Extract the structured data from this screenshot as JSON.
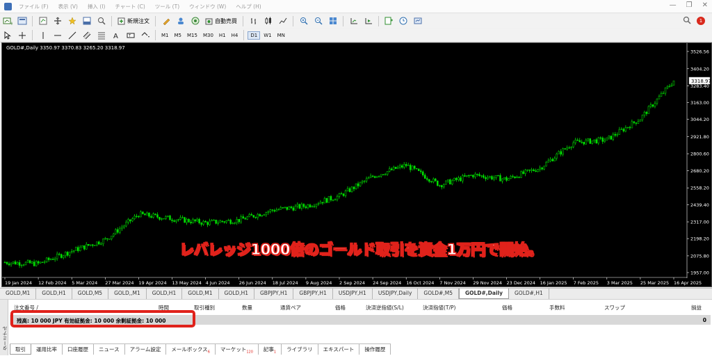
{
  "menu": {
    "items": [
      "ファイル (F)",
      "表示 (V)",
      "挿入 (I)",
      "チャート (C)",
      "ツール (T)",
      "ウィンドウ (W)",
      "ヘルプ (H)"
    ],
    "window_controls": [
      "—",
      "❐",
      "✕"
    ]
  },
  "toolbar": {
    "new_order": "新規注文",
    "auto_trade": "自動売買",
    "timeframes": [
      "M1",
      "M5",
      "M15",
      "M30",
      "H1",
      "H4",
      "D1",
      "W1",
      "MN"
    ],
    "active_timeframe": "D1",
    "notification_count": "1"
  },
  "chart": {
    "header": "GOLD#,Daily  3350.97 3370.83 3265.20 3318.97",
    "price_label": "3318.97",
    "caption": "レバレッジ1000倍のゴールド取引を資金1万円で開始。",
    "colors": {
      "background": "#000000",
      "candles": "#00e000",
      "axis_text": "#ffffff"
    }
  },
  "chart_data": {
    "type": "line",
    "title": "GOLD#,Daily",
    "ohlc_last": {
      "open": 3350.97,
      "high": 3370.83,
      "low": 3265.2,
      "close": 3318.97
    },
    "y_ticks": [
      "3526.56",
      "3404.20",
      "3283.40",
      "3163.00",
      "3044.20",
      "2921.80",
      "2800.60",
      "2680.20",
      "2558.20",
      "2439.40",
      "2317.00",
      "2198.20",
      "2075.80",
      "1957.00"
    ],
    "ylim": [
      1957.0,
      3526.56
    ],
    "x_ticks": [
      "19 Jan 2024",
      "12 Feb 2024",
      "5 Mar 2024",
      "27 Mar 2024",
      "19 Apr 2024",
      "13 May 2024",
      "4 Jun 2024",
      "26 Jun 2024",
      "18 Jul 2024",
      "9 Aug 2024",
      "2 Sep 2024",
      "24 Sep 2024",
      "16 Oct 2024",
      "7 Nov 2024",
      "29 Nov 2024",
      "23 Dec 2024",
      "16 Jan 2025",
      "7 Feb 2025",
      "3 Mar 2025",
      "25 Mar 2025",
      "16 Apr 2025"
    ],
    "x": [
      "19 Jan 2024",
      "12 Feb 2024",
      "5 Mar 2024",
      "27 Mar 2024",
      "19 Apr 2024",
      "13 May 2024",
      "4 Jun 2024",
      "26 Jun 2024",
      "18 Jul 2024",
      "9 Aug 2024",
      "2 Sep 2024",
      "24 Sep 2024",
      "16 Oct 2024",
      "7 Nov 2024",
      "29 Nov 2024",
      "23 Dec 2024",
      "16 Jan 2025",
      "7 Feb 2025",
      "3 Mar 2025",
      "25 Mar 2025",
      "16 Apr 2025"
    ],
    "series": [
      {
        "values": [
          2030,
          2020,
          2110,
          2190,
          2370,
          2340,
          2310,
          2330,
          2400,
          2430,
          2500,
          2640,
          2720,
          2580,
          2650,
          2620,
          2700,
          2880,
          2900,
          3050,
          3318.97
        ]
      }
    ],
    "grid": false
  },
  "chart_tabs": [
    "GOLD,M1",
    "GOLD,H1",
    "GOLD,M5",
    "GOLD,,M1",
    "GOLD,H1",
    "GOLD,M1",
    "GOLD,H1",
    "GBPJPY,H1",
    "GBPJPY,H1",
    "USDJPY,H1",
    "USDJPY,Daily",
    "GOLD#,M5",
    "GOLD#,Daily",
    "GOLD#,H1"
  ],
  "active_chart_tab": "GOLD#,Daily",
  "terminal": {
    "side_label": "ターミナル",
    "columns": [
      "注文番号 /",
      "時間",
      "取引種別",
      "数量",
      "通貨ペア",
      "価格",
      "決済逆指値(S/L)",
      "決済指値(T/P)",
      "価格",
      "手数料",
      "スワップ",
      "損益"
    ],
    "balance_text": "残高: 10 000 JPY  有効証拠金: 10 000  余剰証拠金: 10 000",
    "balance_profit": "0",
    "tabs": [
      {
        "label": "取引",
        "badge": ""
      },
      {
        "label": "運用比率",
        "badge": ""
      },
      {
        "label": "口座履歴",
        "badge": ""
      },
      {
        "label": "ニュース",
        "badge": ""
      },
      {
        "label": "アラーム設定",
        "badge": ""
      },
      {
        "label": "メールボックス",
        "badge": "6"
      },
      {
        "label": "マーケット",
        "badge": "120"
      },
      {
        "label": "記事",
        "badge": "1"
      },
      {
        "label": "ライブラリ",
        "badge": ""
      },
      {
        "label": "エキスパート",
        "badge": ""
      },
      {
        "label": "操作履歴",
        "badge": ""
      }
    ]
  }
}
